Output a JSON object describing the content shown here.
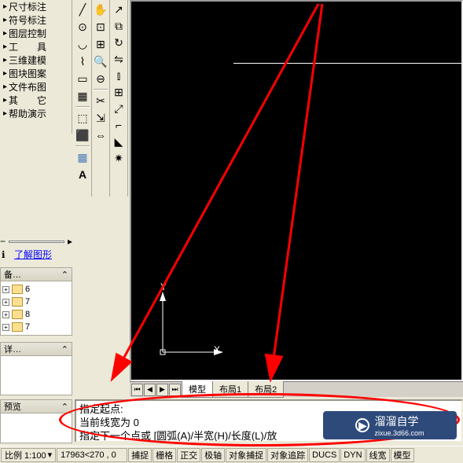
{
  "tree": {
    "items": [
      "尺寸标注",
      "符号标注",
      "图层控制",
      "工　　具",
      "三维建模",
      "图块图案",
      "文件布图",
      "其　　它",
      "帮助演示"
    ]
  },
  "link": {
    "text": "了解图形"
  },
  "panels": {
    "backup": {
      "title": "备…",
      "folders": [
        "6",
        "7",
        "8",
        "7"
      ]
    },
    "detail": {
      "title": "详…"
    },
    "preview": {
      "title": "预览"
    }
  },
  "tabs": {
    "model": "模型",
    "layout1": "布局1",
    "layout2": "布局2"
  },
  "command": {
    "line1": "指定起点:",
    "line2": "当前线宽为  0",
    "line3": "指定下一个点或  [圆弧(A)/半宽(H)/长度(L)/放"
  },
  "status": {
    "scale_label": "比例 1:100",
    "coords": "17963<270 , 0",
    "buttons": [
      "捕捉",
      "栅格",
      "正交",
      "极轴",
      "对象捕捉",
      "对象追踪",
      "DUCS",
      "DYN",
      "线宽",
      "模型"
    ]
  },
  "ucs": {
    "x": "X",
    "y": "Y"
  },
  "watermark": {
    "main": "溜溜自学",
    "sub": "zixue.3d66.com"
  }
}
